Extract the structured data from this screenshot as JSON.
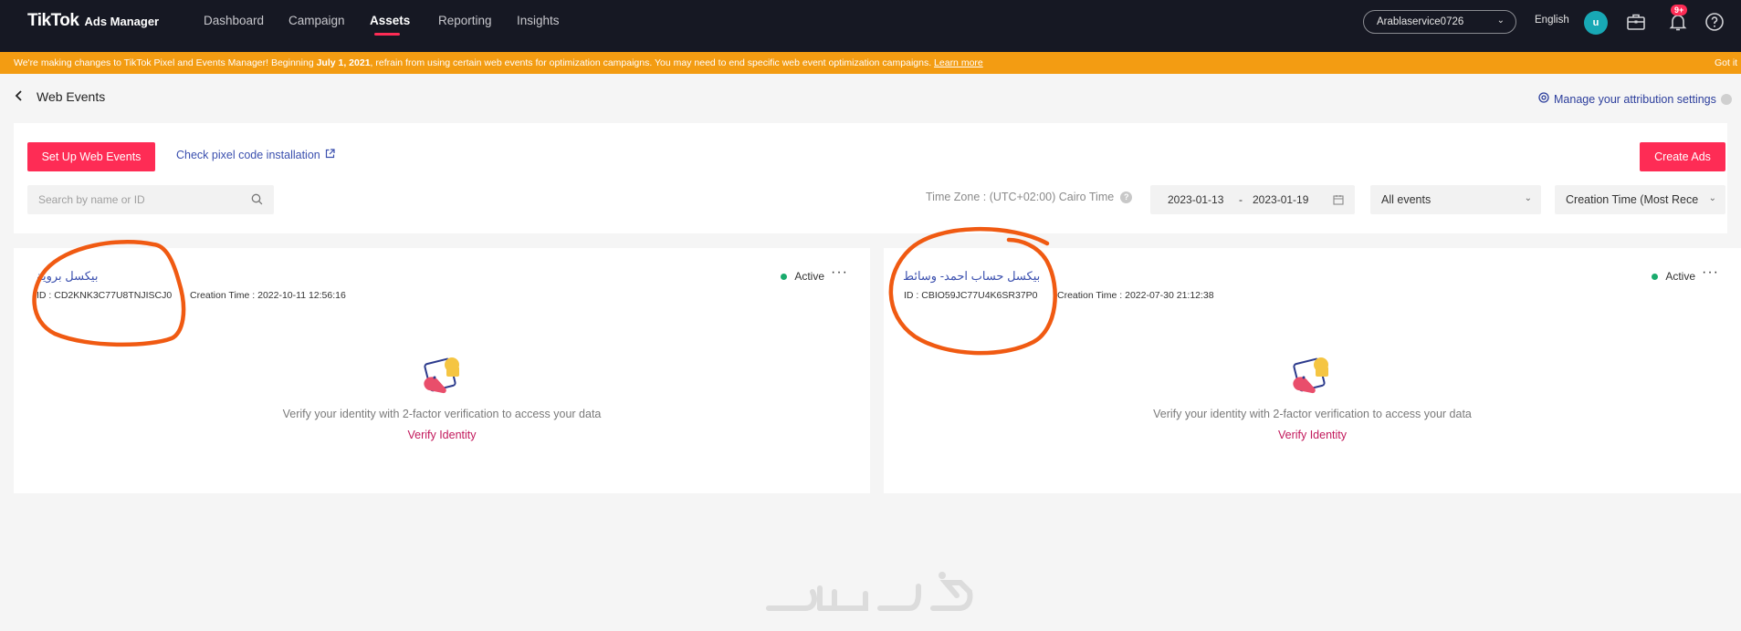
{
  "topbar": {
    "logo_main": "TikTok",
    "logo_sub": "Ads Manager",
    "nav": [
      "Dashboard",
      "Campaign",
      "Assets",
      "Reporting",
      "Insights"
    ],
    "account": "Arablaservice0726",
    "language": "English",
    "avatar_letter": "u",
    "notification_count": "9+"
  },
  "banner": {
    "text_1": "We're making changes to TikTok Pixel and Events Manager! Beginning ",
    "date": "July 1, 2021",
    "text_2": ", refrain from using certain web events for optimization campaigns. You may need to end specific web event optimization campaigns. ",
    "learn_more": "Learn more",
    "got_it": "Got it"
  },
  "page": {
    "title": "Web Events",
    "attribution_link": "Manage your attribution settings"
  },
  "toolbar": {
    "setup_button": "Set Up Web Events",
    "check_link": "Check pixel code installation",
    "create_ads": "Create Ads",
    "search_placeholder": "Search by name or ID",
    "timezone": "Time Zone : (UTC+02:00) Cairo Time",
    "date_start": "2023-01-13",
    "date_sep": "-",
    "date_end": "2023-01-19",
    "events_filter": "All events",
    "sort": "Creation Time (Most Rece"
  },
  "pixels": [
    {
      "name": "بيكسل بروية",
      "id": "ID : CD2KNK3C77U8TNJISCJ0",
      "created": "Creation Time : 2022-10-11 12:56:16",
      "status": "Active",
      "verify_text": "Verify your identity with 2-factor verification to access your data",
      "verify_link": "Verify Identity"
    },
    {
      "name": "بيكسل حساب احمد- وسائط",
      "id": "ID : CBIO59JC77U4K6SR37P0",
      "created": "Creation Time : 2022-07-30 21:12:38",
      "status": "Active",
      "verify_text": "Verify your identity with 2-factor verification to access your data",
      "verify_link": "Verify Identity"
    }
  ],
  "colors": {
    "topbar": "#161823",
    "banner": "#f39c12",
    "primary": "#fe2c55",
    "link": "#3a4fae",
    "annotation": "#f05a12"
  }
}
